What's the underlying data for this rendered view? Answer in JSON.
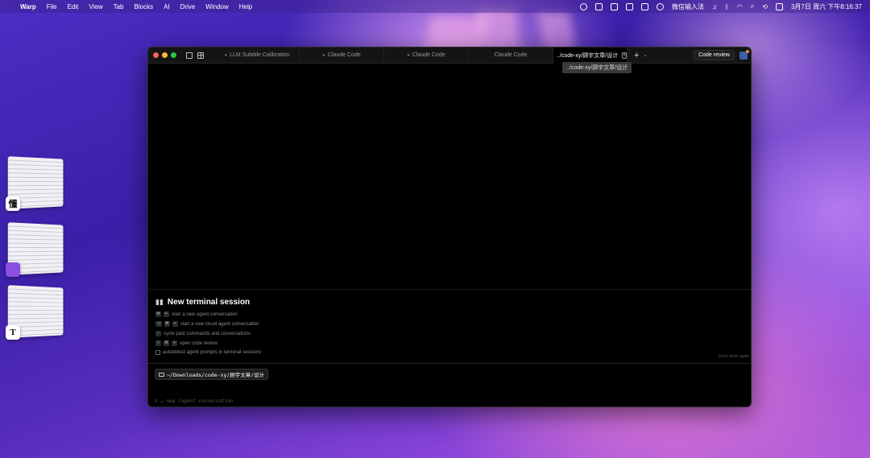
{
  "menubar": {
    "app_name": "Warp",
    "menus": [
      "File",
      "Edit",
      "View",
      "Tab",
      "Blocks",
      "AI",
      "Drive",
      "Window",
      "Help"
    ],
    "input_method": "微信输入法",
    "datetime": "3月7日 周六  下午8:16:37"
  },
  "stage_manager": [
    {
      "app_label": "懂"
    },
    {
      "app_label": ""
    },
    {
      "app_label": "T"
    }
  ],
  "window": {
    "tabs": [
      {
        "label": "LLM Subtitle Calibration",
        "active": false
      },
      {
        "label": "Claude Code",
        "active": false
      },
      {
        "label": "Claude Code",
        "active": false
      },
      {
        "label": "Claude Code",
        "active": false
      },
      {
        "label": "../code-xy/顾宇文章/设计",
        "active": true
      }
    ],
    "close_tab": "×",
    "add_tab": "+",
    "tab_menu": "⌄",
    "code_review_label": "Code review",
    "tooltip": "../code-xy/顾宇文章/设计",
    "session": {
      "title": "New terminal session",
      "hints": [
        {
          "keys": [
            "⌘",
            "↵"
          ],
          "text": "start a new agent conversation"
        },
        {
          "keys": [
            "⌥",
            "⌘",
            "↵"
          ],
          "text": "start a new cloud agent conversation"
        },
        {
          "keys": [
            "↑"
          ],
          "text": "cycle past commands and conversations"
        },
        {
          "keys": [
            "⇧",
            "⌘",
            "+"
          ],
          "text": "open code review"
        },
        {
          "keys": [],
          "text": "autodetect agent prompts in terminal sessions"
        }
      ],
      "dont_show": "Don't show again"
    },
    "input": {
      "path": "~/Downloads/code-xy/顾宇文章/设计",
      "hint": "⌘ ↵ new /agent conversation"
    }
  }
}
